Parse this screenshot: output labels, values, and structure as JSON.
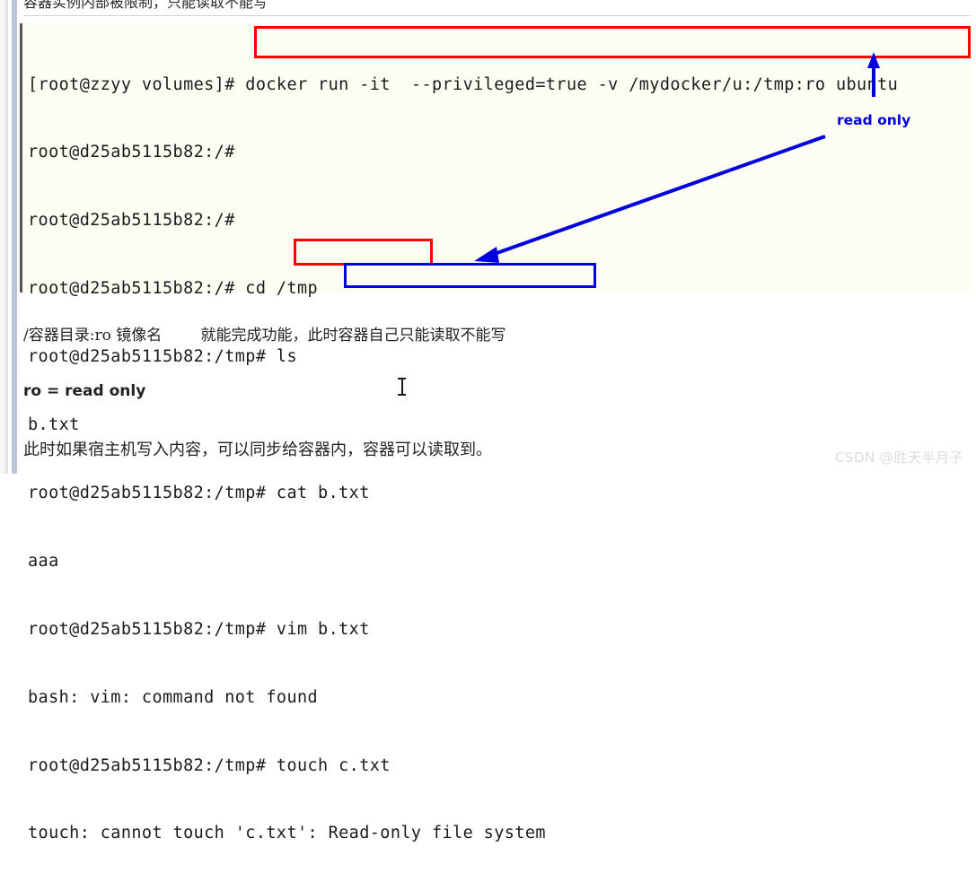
{
  "page": {
    "top_truncated_note": "容器实例内部被限制，只能读取不能写",
    "watermark": "CSDN @胜天半月子"
  },
  "terminal": {
    "lines": [
      "[root@zzyy volumes]# docker run -it  --privileged=true -v /mydocker/u:/tmp:ro ubuntu",
      "root@d25ab5115b82:/#",
      "root@d25ab5115b82:/#",
      "root@d25ab5115b82:/# cd /tmp",
      "root@d25ab5115b82:/tmp# ls",
      "b.txt",
      "root@d25ab5115b82:/tmp# cat b.txt",
      "aaa",
      "root@d25ab5115b82:/tmp# vim b.txt",
      "bash: vim: command not found",
      "root@d25ab5115b82:/tmp# touch c.txt",
      "touch: cannot touch 'c.txt': Read-only file system"
    ],
    "highlights": {
      "docker_command": "docker run -it  --privileged=true -v /mydocker/u:/tmp:ro ubuntu",
      "touch_command": "touch c.txt",
      "error_phrase": "Read-only file system"
    }
  },
  "annotations": {
    "read_only_label": "read only",
    "arrow_to_ro_flag": "blue-arrow-up-to-ro-option",
    "arrow_to_error": "blue-arrow-to-read-only-file-system"
  },
  "notes": {
    "syntax_line": "/容器目录:ro 镜像名        就能完成功能，此时容器自己只能读取不能写",
    "ro_meaning": "ro = read only",
    "bottom_line": "此时如果宿主机写入内容，可以同步给容器内，容器可以读取到。"
  },
  "colors": {
    "highlight_red": "#ff0000",
    "highlight_blue": "#0000dd",
    "terminal_bg": "#fdfdf4",
    "terminal_text": "#1c1c1c",
    "watermark": "#dcdcdc"
  }
}
